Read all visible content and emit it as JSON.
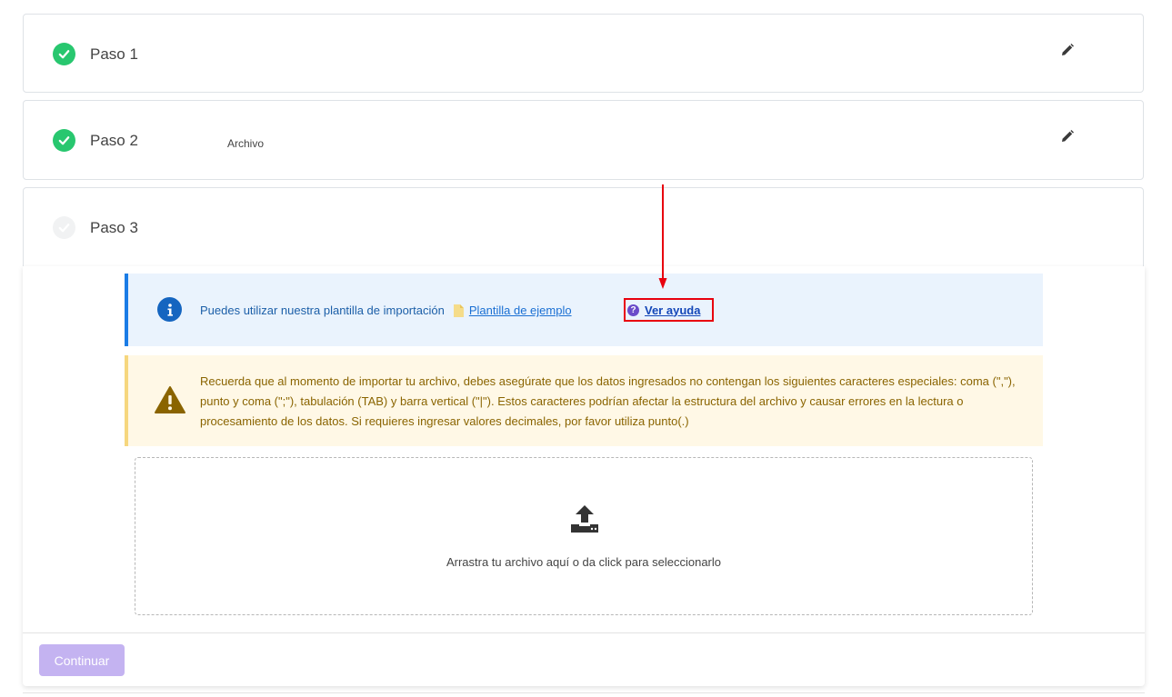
{
  "steps": [
    {
      "label": "Paso 1",
      "sub": "",
      "status": "done"
    },
    {
      "label": "Paso 2",
      "sub": "Archivo",
      "status": "done"
    },
    {
      "label": "Paso 3",
      "sub": "",
      "status": "pending"
    }
  ],
  "info": {
    "text": "Puedes utilizar nuestra plantilla de importación",
    "template_link": "Plantilla de ejemplo",
    "help_link": "Ver ayuda"
  },
  "warning": {
    "text": "Recuerda que al momento de importar tu archivo, debes asegúrate que los datos ingresados no contengan los siguientes caracteres especiales: coma (\",\"), punto y coma (\";\"), tabulación (TAB) y barra vertical (\"|\"). Estos caracteres podrían afectar la estructura del archivo y causar errores en la lectura o procesamiento de los datos. Si requieres ingresar valores decimales, por favor utiliza punto(.)"
  },
  "dropzone": {
    "text": "Arrastra tu archivo aquí o da click para seleccionarlo"
  },
  "buttons": {
    "continue": "Continuar"
  },
  "colors": {
    "success": "#28c76f",
    "info_accent": "#1a7ce6",
    "warning_text": "#8a6400",
    "annotation_red": "#e8000e",
    "continue_disabled": "#c4b3f1"
  }
}
